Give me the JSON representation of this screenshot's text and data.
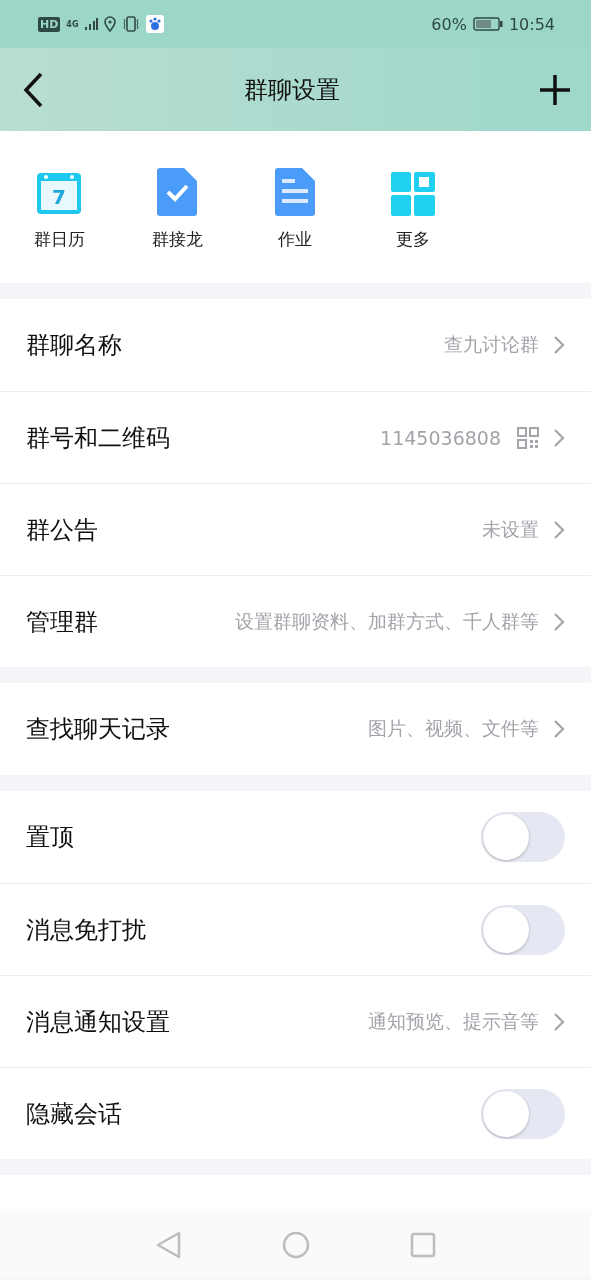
{
  "status_bar": {
    "hd": "HD",
    "network": "4G",
    "battery": "60%",
    "time": "10:54"
  },
  "header": {
    "title": "群聊设置"
  },
  "shortcuts": [
    {
      "kind": "calendar",
      "label": "群日历",
      "icon_text": "7"
    },
    {
      "kind": "check",
      "label": "群接龙"
    },
    {
      "kind": "doc",
      "label": "作业"
    },
    {
      "kind": "grid",
      "label": "更多"
    }
  ],
  "sections": [
    [
      {
        "kind": "link",
        "label": "群聊名称",
        "value": "查九讨论群"
      },
      {
        "kind": "link",
        "label": "群号和二维码",
        "value": "1145036808",
        "qr": true
      },
      {
        "kind": "link",
        "label": "群公告",
        "value": "未设置"
      },
      {
        "kind": "link",
        "label": "管理群",
        "value": "设置群聊资料、加群方式、千人群等"
      }
    ],
    [
      {
        "kind": "link",
        "label": "查找聊天记录",
        "value": "图片、视频、文件等"
      }
    ],
    [
      {
        "kind": "toggle",
        "label": "置顶",
        "on": false
      },
      {
        "kind": "toggle",
        "label": "消息免打扰",
        "on": false
      },
      {
        "kind": "link",
        "label": "消息通知设置",
        "value": "通知预览、提示音等"
      },
      {
        "kind": "toggle",
        "label": "隐藏会话",
        "on": false
      }
    ]
  ]
}
